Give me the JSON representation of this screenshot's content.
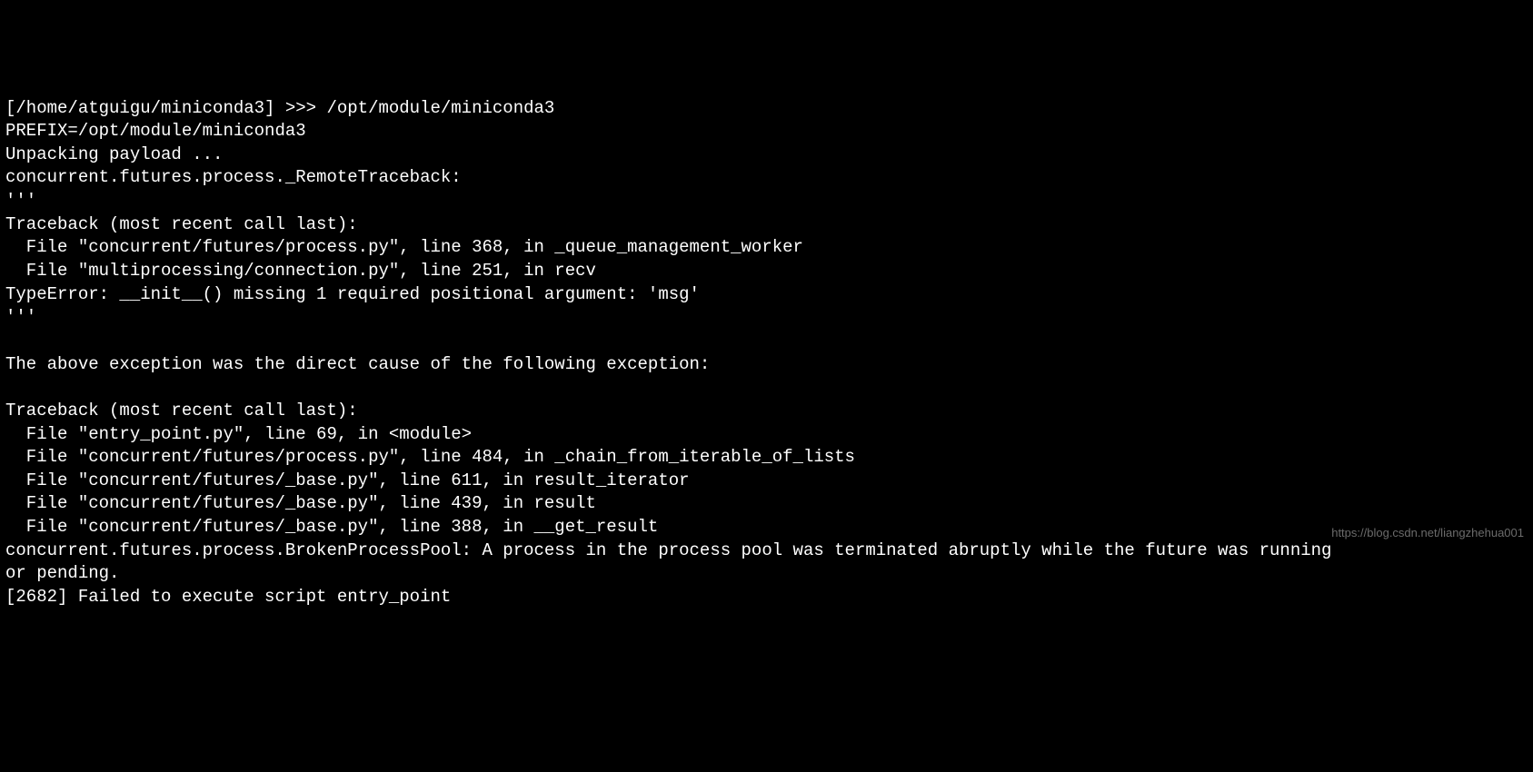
{
  "terminal": {
    "lines": [
      "[/home/atguigu/miniconda3] >>> /opt/module/miniconda3",
      "PREFIX=/opt/module/miniconda3",
      "Unpacking payload ...",
      "concurrent.futures.process._RemoteTraceback:",
      "'''",
      "Traceback (most recent call last):",
      "  File \"concurrent/futures/process.py\", line 368, in _queue_management_worker",
      "  File \"multiprocessing/connection.py\", line 251, in recv",
      "TypeError: __init__() missing 1 required positional argument: 'msg'",
      "'''",
      "",
      "The above exception was the direct cause of the following exception:",
      "",
      "Traceback (most recent call last):",
      "  File \"entry_point.py\", line 69, in <module>",
      "  File \"concurrent/futures/process.py\", line 484, in _chain_from_iterable_of_lists",
      "  File \"concurrent/futures/_base.py\", line 611, in result_iterator",
      "  File \"concurrent/futures/_base.py\", line 439, in result",
      "  File \"concurrent/futures/_base.py\", line 388, in __get_result",
      "concurrent.futures.process.BrokenProcessPool: A process in the process pool was terminated abruptly while the future was running",
      "or pending.",
      "[2682] Failed to execute script entry_point"
    ]
  },
  "watermark": {
    "text": "https://blog.csdn.net/liangzhehua001"
  }
}
